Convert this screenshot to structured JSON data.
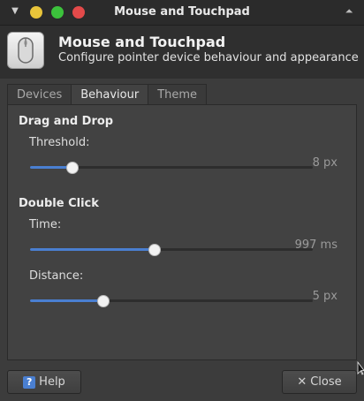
{
  "window": {
    "title": "Mouse and Touchpad",
    "menu_icon": "down-arrow-icon",
    "shade_icon": "shade-up-icon"
  },
  "header": {
    "title": "Mouse and Touchpad",
    "subtitle": "Configure pointer device behaviour and appearance",
    "icon": "mouse-icon"
  },
  "tabs": [
    {
      "label": "Devices",
      "active": false
    },
    {
      "label": "Behaviour",
      "active": true
    },
    {
      "label": "Theme",
      "active": false
    }
  ],
  "drag_and_drop": {
    "title": "Drag and Drop",
    "threshold": {
      "label": "Threshold:",
      "value_text": "8 px",
      "fraction": 0.15
    }
  },
  "double_click": {
    "title": "Double Click",
    "time": {
      "label": "Time:",
      "value_text": "997 ms",
      "fraction": 0.44
    },
    "distance": {
      "label": "Distance:",
      "value_text": "5 px",
      "fraction": 0.26
    }
  },
  "buttons": {
    "help": {
      "label": "Help",
      "icon": "help-icon"
    },
    "close": {
      "label": "Close",
      "icon": "close-icon"
    }
  },
  "colors": {
    "accent": "#4a7fd1",
    "minimize": "#e8c43a",
    "maximize": "#3cc23c",
    "close": "#e34a4a"
  }
}
